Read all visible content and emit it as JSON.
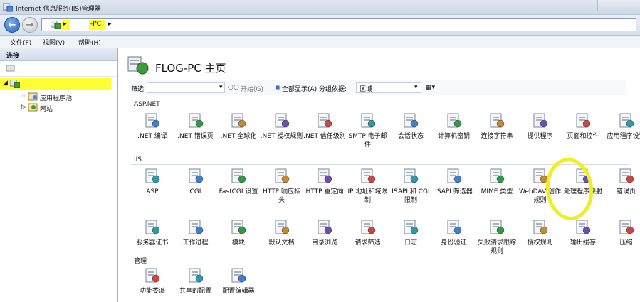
{
  "window": {
    "title": "Internet 信息服务(IIS)管理器"
  },
  "address": {
    "segments": [
      "",
      "-PC"
    ]
  },
  "menu": {
    "items": [
      "文件(F)",
      "视图(V)",
      "帮助(H)"
    ]
  },
  "left_pane": {
    "header": "连接",
    "tree": {
      "root_label": "",
      "children": [
        "应用程序池",
        "网站"
      ]
    }
  },
  "page": {
    "title": "FLOG-PC 主页",
    "filter_bar": {
      "filter_label": "筛选:",
      "start_label": "开始(G)",
      "show_all_label": "全部显示(A)",
      "group_label": "分组依据:",
      "group_value": "区域"
    },
    "sections": [
      {
        "label": "ASP.NET",
        "items": [
          {
            "label": ".NET 编译",
            "icon": "compile-icon"
          },
          {
            "label": ".NET 错误页",
            "icon": "error-page-icon"
          },
          {
            "label": ".NET 全球化",
            "icon": "globe-icon"
          },
          {
            "label": ".NET 授权规则",
            "icon": "lock-icon"
          },
          {
            "label": ".NET 信任级别",
            "icon": "trust-icon"
          },
          {
            "label": "SMTP 电子邮件",
            "icon": "mail-icon"
          },
          {
            "label": "会话状态",
            "icon": "session-icon"
          },
          {
            "label": "计算机密钥",
            "icon": "key-icon"
          },
          {
            "label": "连接字符串",
            "icon": "database-icon"
          },
          {
            "label": "提供程序",
            "icon": "provider-icon"
          },
          {
            "label": "页面和控件",
            "icon": "page-icon"
          },
          {
            "label": "应用程序设置",
            "icon": "settings-icon"
          }
        ]
      },
      {
        "label": "IIS",
        "items": [
          {
            "label": "ASP",
            "icon": "asp-icon"
          },
          {
            "label": "CGI",
            "icon": "cgi-icon"
          },
          {
            "label": "FastCGI 设置",
            "icon": "fastcgi-icon"
          },
          {
            "label": "HTTP 响应标头",
            "icon": "http-headers-icon"
          },
          {
            "label": "HTTP 重定向",
            "icon": "redirect-icon"
          },
          {
            "label": "IP 地址和域限制",
            "icon": "ip-icon"
          },
          {
            "label": "ISAPI 和 CGI 限制",
            "icon": "isapi-cgi-icon"
          },
          {
            "label": "ISAPI 筛选器",
            "icon": "isapi-filter-icon"
          },
          {
            "label": "MIME 类型",
            "icon": "mime-icon"
          },
          {
            "label": "WebDAV 创作规则",
            "icon": "webdav-icon"
          },
          {
            "label": "处理程序映射",
            "icon": "handler-mapping-icon"
          },
          {
            "label": "错误页",
            "icon": "error-icon"
          },
          {
            "label": "服务器证书",
            "icon": "certificate-icon"
          },
          {
            "label": "工作进程",
            "icon": "worker-process-icon"
          },
          {
            "label": "模块",
            "icon": "modules-icon"
          },
          {
            "label": "默认文档",
            "icon": "default-doc-icon"
          },
          {
            "label": "目录浏览",
            "icon": "directory-icon"
          },
          {
            "label": "请求筛选",
            "icon": "request-filter-icon"
          },
          {
            "label": "日志",
            "icon": "log-icon"
          },
          {
            "label": "身份验证",
            "icon": "auth-icon"
          },
          {
            "label": "失败请求跟踪规则",
            "icon": "trace-icon"
          },
          {
            "label": "授权规则",
            "icon": "authz-icon"
          },
          {
            "label": "输出缓存",
            "icon": "output-cache-icon"
          },
          {
            "label": "压缩",
            "icon": "compression-icon"
          }
        ]
      },
      {
        "label": "管理",
        "items": [
          {
            "label": "功能委派",
            "icon": "delegation-icon"
          },
          {
            "label": "共享的配置",
            "icon": "shared-config-icon"
          },
          {
            "label": "配置编辑器",
            "icon": "config-editor-icon"
          }
        ]
      }
    ]
  },
  "colors": {
    "highlight": "#ffff33",
    "annotation": "#f0ee20"
  }
}
